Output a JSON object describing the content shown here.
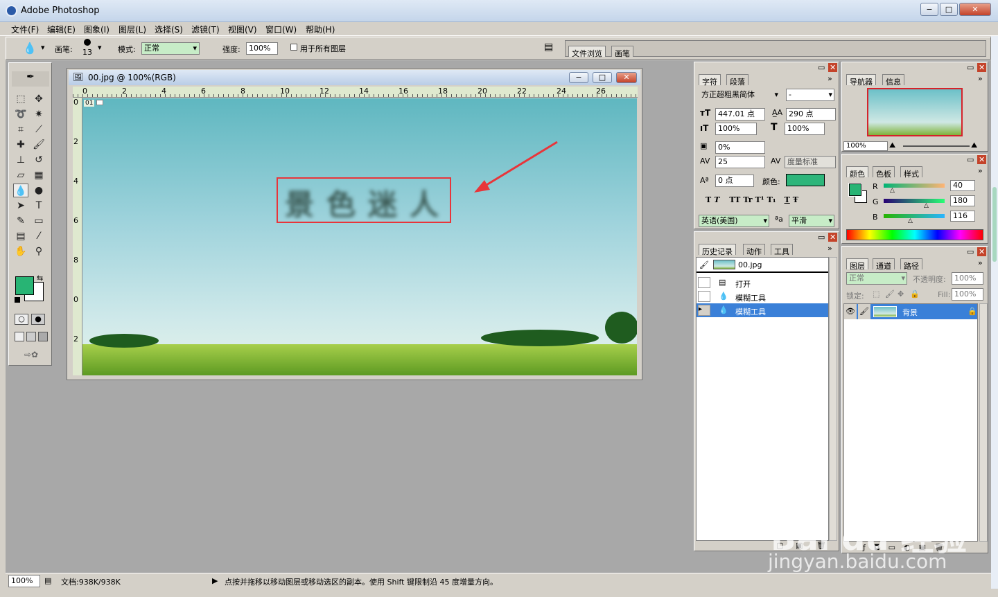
{
  "titlebar": {
    "title": "Adobe Photoshop",
    "minimize": "−",
    "restore": "□",
    "close": "✕"
  },
  "menu": [
    "文件(F)",
    "编辑(E)",
    "图象(I)",
    "图层(L)",
    "选择(S)",
    "滤镜(T)",
    "视图(V)",
    "窗口(W)",
    "帮助(H)"
  ],
  "options": {
    "brush_label": "画笔:",
    "brush_size": "13",
    "mode_label": "模式:",
    "mode_value": "正常",
    "strength_label": "强度:",
    "strength_value": "100%",
    "all_layers_label": "用于所有图层",
    "well_tabs": [
      "文件浏览",
      "画笔"
    ]
  },
  "document": {
    "title": "00.jpg @ 100%(RGB)",
    "ruler_top": [
      "0",
      "2",
      "4",
      "6",
      "8",
      "10",
      "12",
      "14",
      "16",
      "18",
      "20",
      "22",
      "24",
      "26"
    ],
    "ruler_left": [
      "0",
      "2",
      "4",
      "6",
      "8",
      "0",
      "2"
    ],
    "slice_label": "01",
    "blurred_text": "景色迷人"
  },
  "character_panel": {
    "tabs": [
      "字符",
      "段落"
    ],
    "font_family": "方正超粗黑简体",
    "font_style": "-",
    "font_size": "447.01 点",
    "leading": "290 点",
    "vertical_scale": "100%",
    "horizontal_scale": "100%",
    "tsume": "0%",
    "kerning": "25",
    "tracking": "度量标准",
    "baseline_shift": "0 点",
    "color_label": "颜色:",
    "text_color": "#2db57a",
    "style_buttons": [
      "T",
      "T",
      "TT",
      "Tr",
      "T¹",
      "T₁",
      "T",
      "Ŧ"
    ],
    "language": "英语(美国)",
    "aa_label": "ªa",
    "antialias": "平滑"
  },
  "navigator_panel": {
    "tabs": [
      "导航器",
      "信息"
    ],
    "zoom": "100%"
  },
  "color_panel": {
    "tabs": [
      "颜色",
      "色板",
      "样式"
    ],
    "fg_color": "#28b474",
    "channels": [
      {
        "label": "R",
        "value": "40"
      },
      {
        "label": "G",
        "value": "180"
      },
      {
        "label": "B",
        "value": "116"
      }
    ]
  },
  "history_panel": {
    "tabs": [
      "历史记录",
      "动作",
      "工具"
    ],
    "snapshot": "00.jpg",
    "items": [
      "打开",
      "模糊工具",
      "模糊工具"
    ]
  },
  "layers_panel": {
    "tabs": [
      "图层",
      "通道",
      "路径"
    ],
    "blend_mode": "正常",
    "opacity_label": "不透明度:",
    "opacity": "100%",
    "lock_label": "锁定:",
    "fill_label": "Fill:",
    "fill": "100%",
    "layers": [
      {
        "name": "背景"
      }
    ]
  },
  "toolbox": {
    "fg_color": "#28b474",
    "bg_color": "#ffffff"
  },
  "statusbar": {
    "zoom": "100%",
    "doc_info": "文档:938K/938K",
    "hint": "点按并拖移以移动图层或移动选区的副本。使用 Shift 键限制沿 45 度增量方向。"
  },
  "watermark": {
    "brand": "Bai du 经验",
    "url": "jingyan.baidu.com"
  }
}
